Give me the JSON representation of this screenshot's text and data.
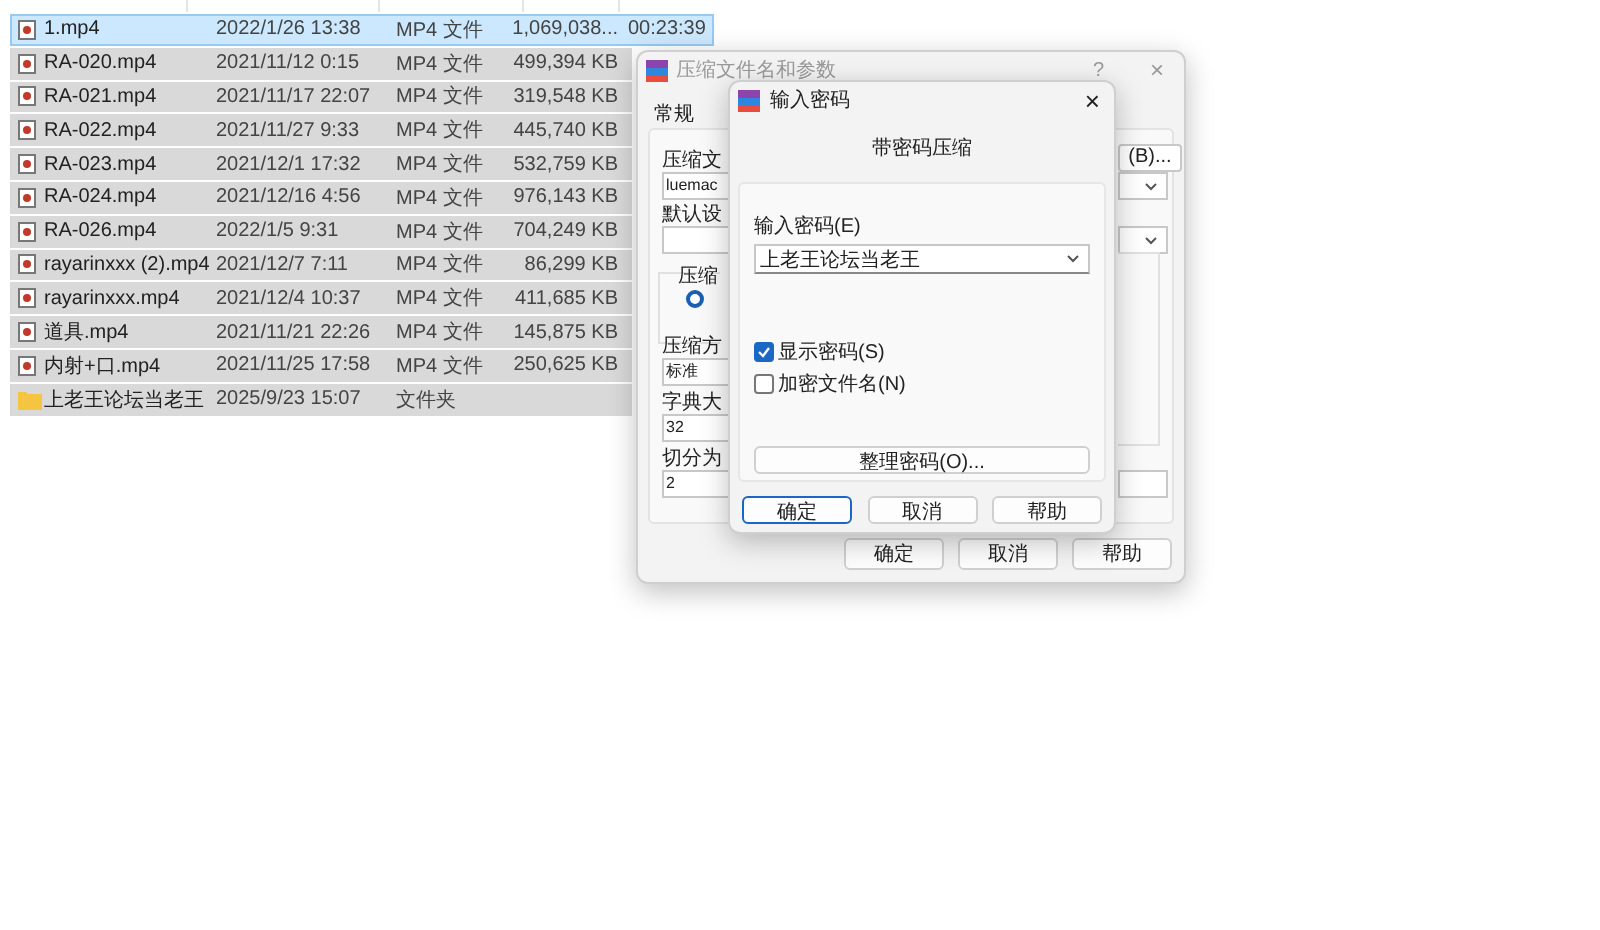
{
  "files": [
    {
      "kind": "video",
      "name": "1.mp4",
      "date": "2022/1/26 13:38",
      "type": "MP4 文件",
      "size": "1,069,038...",
      "duration": "00:23:39",
      "selected": true
    },
    {
      "kind": "video",
      "name": "RA-020.mp4",
      "date": "2021/11/12 0:15",
      "type": "MP4 文件",
      "size": "499,394 KB",
      "selected": false
    },
    {
      "kind": "video",
      "name": "RA-021.mp4",
      "date": "2021/11/17 22:07",
      "type": "MP4 文件",
      "size": "319,548 KB",
      "selected": false
    },
    {
      "kind": "video",
      "name": "RA-022.mp4",
      "date": "2021/11/27 9:33",
      "type": "MP4 文件",
      "size": "445,740 KB",
      "selected": false
    },
    {
      "kind": "video",
      "name": "RA-023.mp4",
      "date": "2021/12/1 17:32",
      "type": "MP4 文件",
      "size": "532,759 KB",
      "selected": false
    },
    {
      "kind": "video",
      "name": "RA-024.mp4",
      "date": "2021/12/16 4:56",
      "type": "MP4 文件",
      "size": "976,143 KB",
      "selected": false
    },
    {
      "kind": "video",
      "name": "RA-026.mp4",
      "date": "2022/1/5 9:31",
      "type": "MP4 文件",
      "size": "704,249 KB",
      "selected": false
    },
    {
      "kind": "video",
      "name": "rayarinxxx (2).mp4",
      "date": "2021/12/7 7:11",
      "type": "MP4 文件",
      "size": "86,299 KB",
      "selected": false
    },
    {
      "kind": "video",
      "name": "rayarinxxx.mp4",
      "date": "2021/12/4 10:37",
      "type": "MP4 文件",
      "size": "411,685 KB",
      "selected": false
    },
    {
      "kind": "video",
      "name": "道具.mp4",
      "date": "2021/11/21 22:26",
      "type": "MP4 文件",
      "size": "145,875 KB",
      "selected": false
    },
    {
      "kind": "video",
      "name": "内射+口.mp4",
      "date": "2021/11/25 17:58",
      "type": "MP4 文件",
      "size": "250,625 KB",
      "selected": false
    },
    {
      "kind": "folder",
      "name": "上老王论坛当老王",
      "date": "2025/9/23 15:07",
      "type": "文件夹",
      "selected": false
    }
  ],
  "archive_dialog": {
    "title": "压缩文件名和参数",
    "help": "?",
    "close": "×",
    "tab": "常规",
    "labels": [
      "压缩文",
      "默认设",
      "压缩",
      "压缩方",
      "字典大",
      "切分为"
    ],
    "filename_value": "luemac",
    "compression_radio": {
      "selected": true
    },
    "browse_button": "(B)...",
    "method_value": "标准",
    "dictionary_value": "32",
    "split_value": "2",
    "buttons": [
      "确定",
      "取消",
      "帮助"
    ]
  },
  "password_dialog": {
    "title": "输入密码",
    "close": "×",
    "heading": "带密码压缩",
    "password_label": "输入密码(E)",
    "password_value": "上老王论坛当老王",
    "options": [
      {
        "label": "显示密码(S)",
        "checked": true
      },
      {
        "label": "加密文件名(N)",
        "checked": false
      }
    ],
    "organize_button": "整理密码(O)...",
    "buttons": [
      {
        "label": "确定",
        "default": true
      },
      {
        "label": "取消",
        "default": false
      },
      {
        "label": "帮助",
        "default": false
      }
    ]
  }
}
